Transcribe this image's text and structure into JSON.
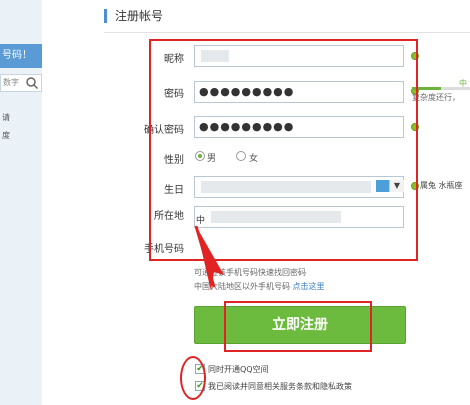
{
  "heading": "注册帐号",
  "left_panel": {
    "banner": "号码！",
    "search_placeholder": "数字",
    "text_1": "请",
    "text_2": "度"
  },
  "form": {
    "nickname_label": "昵称",
    "password_label": "密码",
    "password_value": "●●●●●●●●●",
    "confirm_label": "确认密码",
    "confirm_value": "●●●●●●●●●",
    "gender_label": "性别",
    "gender_male": "男",
    "gender_female": "女",
    "gender_selected": "男",
    "birthday_label": "生日",
    "birthday_side_text": "属兔 水瓶座",
    "location_label": "所在地",
    "location_prefix": "中",
    "phone_label": "手机号码",
    "strength_label": "中",
    "strength_level": 0.5,
    "strength_hint": "复杂度还行，"
  },
  "hints": {
    "phone_hint": "可通过该手机号码快速找回密码",
    "overseas_text": "中国大陆地区以外手机号码",
    "overseas_link": "点击这里"
  },
  "submit_label": "立即注册",
  "checks": {
    "qzone_label": "同时开通QQ空间",
    "agree_label": "我已阅读并同意相关服务条款和隐私政策"
  },
  "colors": {
    "accent_blue": "#4a8fd0",
    "submit_green": "#6dbb3e",
    "annotation_red": "#e02424"
  }
}
